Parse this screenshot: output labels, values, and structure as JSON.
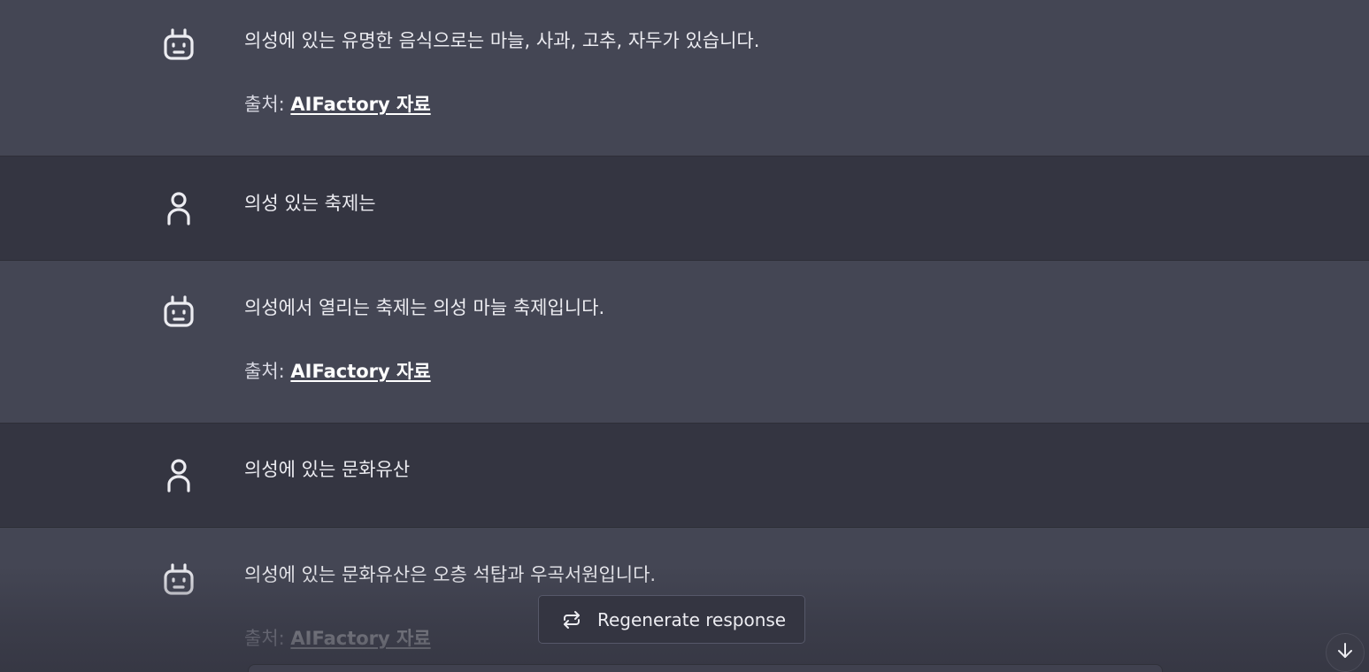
{
  "conversation": [
    {
      "role": "bot",
      "text": "의성에 있는 유명한 음식으로는 마늘, 사과, 고추, 자두가 있습니다.",
      "source_prefix": "출처: ",
      "source_link": "AIFactory 자료"
    },
    {
      "role": "user",
      "text": "의성 있는 축제는"
    },
    {
      "role": "bot",
      "text": "의성에서 열리는 축제는 의성 마늘 축제입니다.",
      "source_prefix": "출처: ",
      "source_link": "AIFactory 자료"
    },
    {
      "role": "user",
      "text": "의성에 있는 문화유산"
    },
    {
      "role": "bot",
      "text": "의성에 있는 문화유산은 오층 석탑과 우곡서원입니다.",
      "source_prefix": "출처: ",
      "source_link": "AIFactory 자료"
    }
  ],
  "regenerate": {
    "label": "Regenerate response",
    "icon": "refresh-icon"
  },
  "scroll": {
    "icon": "arrow-down-icon"
  },
  "colors": {
    "bot_bg": "#444654",
    "user_bg": "#343541",
    "text": "#ececf1",
    "link": "#ffffff"
  }
}
